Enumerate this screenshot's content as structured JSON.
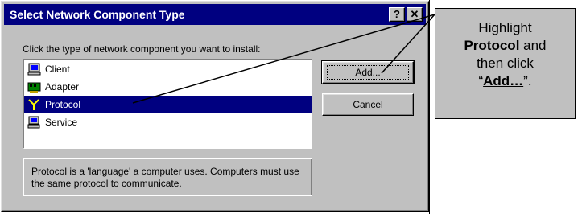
{
  "dialog": {
    "title": "Select Network Component Type",
    "help_glyph": "?",
    "close_glyph": "✕",
    "instruction": "Click the type of network component you want to install:",
    "components": [
      {
        "label": "Client",
        "icon": "client-icon",
        "selected": false
      },
      {
        "label": "Adapter",
        "icon": "adapter-icon",
        "selected": false
      },
      {
        "label": "Protocol",
        "icon": "protocol-icon",
        "selected": true
      },
      {
        "label": "Service",
        "icon": "service-icon",
        "selected": false
      }
    ],
    "add_button": "Add...",
    "cancel_button": "Cancel",
    "description": "Protocol is a 'language' a computer uses. Computers must use the same protocol to communicate."
  },
  "callout": {
    "line1": "Highlight",
    "line2_bold": "Protocol",
    "line2_rest": " and",
    "line3": "then click",
    "quote_open": "“",
    "action_bold": "Add…",
    "quote_close": "”."
  },
  "colors": {
    "title_bar": "#000080",
    "selection": "#000080",
    "face": "#c0c0c0"
  }
}
